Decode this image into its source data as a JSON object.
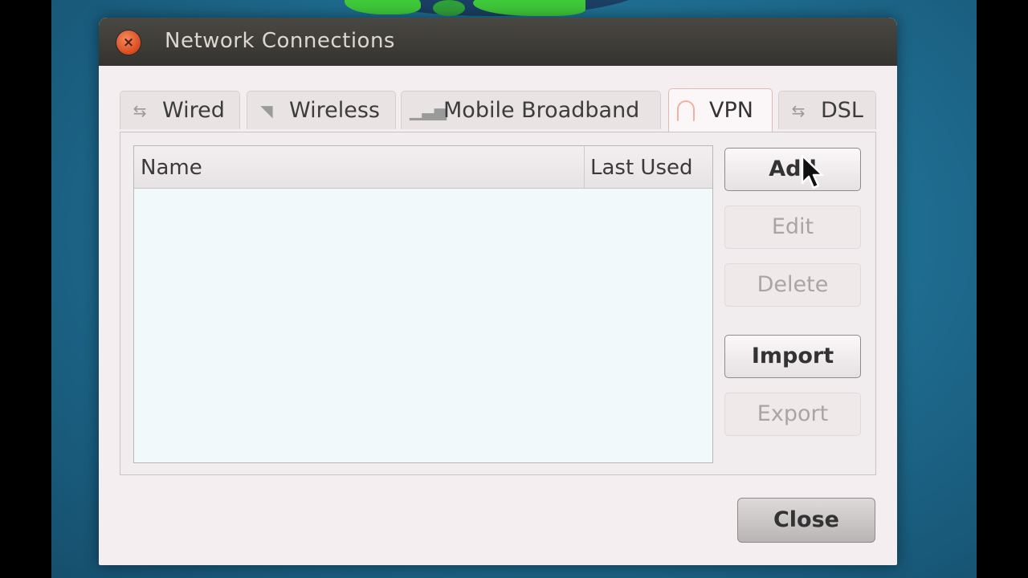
{
  "window": {
    "title": "Network Connections",
    "close_glyph": "×"
  },
  "tabs": [
    {
      "label": "Wired",
      "icon": "wired-icon"
    },
    {
      "label": "Wireless",
      "icon": "wireless-icon"
    },
    {
      "label": "Mobile Broadband",
      "icon": "mobile-broadband-icon"
    },
    {
      "label": "VPN",
      "icon": "vpn-lock-icon",
      "active": true
    },
    {
      "label": "DSL",
      "icon": "dsl-icon"
    }
  ],
  "list": {
    "columns": [
      "Name",
      "Last Used"
    ],
    "rows": []
  },
  "actions": {
    "add": "Add",
    "edit": "Edit",
    "delete": "Delete",
    "import": "Import",
    "export": "Export"
  },
  "footer": {
    "close": "Close"
  }
}
